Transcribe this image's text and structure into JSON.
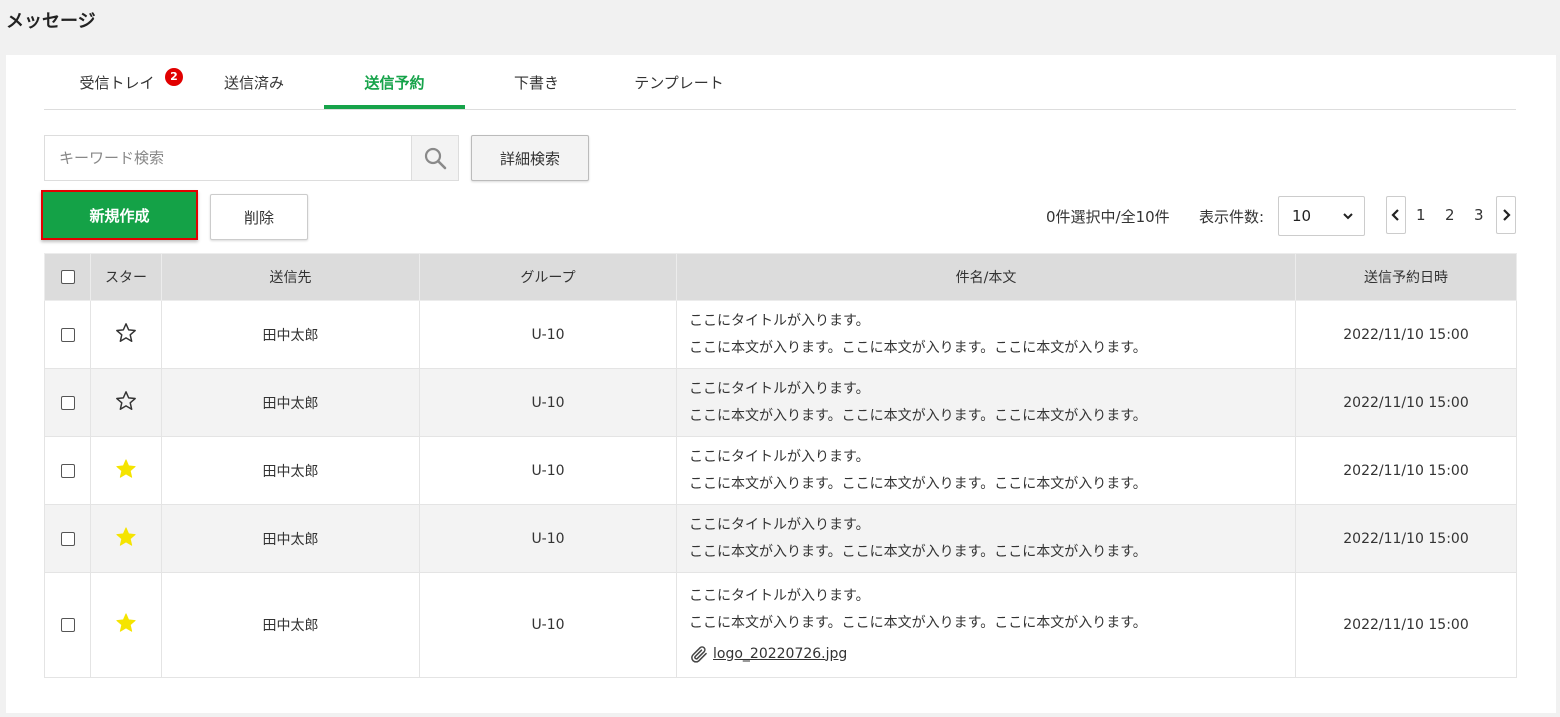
{
  "page": {
    "title": "メッセージ"
  },
  "tabs": [
    {
      "label": "受信トレイ",
      "badge": "2",
      "active": false
    },
    {
      "label": "送信済み",
      "active": false
    },
    {
      "label": "送信予約",
      "active": true
    },
    {
      "label": "下書き",
      "active": false
    },
    {
      "label": "テンプレート",
      "active": false
    }
  ],
  "search": {
    "placeholder": "キーワード検索",
    "value": "",
    "icon": "search-icon",
    "detail_label": "詳細検索"
  },
  "actions": {
    "new_label": "新規作成",
    "delete_label": "削除"
  },
  "selection": {
    "status": "0件選択中/全10件"
  },
  "per_page": {
    "label": "表示件数:",
    "value": "10"
  },
  "pagination": {
    "pages": [
      "1",
      "2",
      "3"
    ]
  },
  "table": {
    "headers": [
      "スター",
      "送信先",
      "グループ",
      "件名/本文",
      "送信予約日時"
    ],
    "rows": [
      {
        "starred": false,
        "recipient": "田中太郎",
        "group": "U-10",
        "title": "ここにタイトルが入ります。",
        "body": "ここに本文が入ります。ここに本文が入ります。ここに本文が入ります。",
        "datetime": "2022/11/10 15:00"
      },
      {
        "starred": false,
        "recipient": "田中太郎",
        "group": "U-10",
        "title": "ここにタイトルが入ります。",
        "body": "ここに本文が入ります。ここに本文が入ります。ここに本文が入ります。",
        "datetime": "2022/11/10 15:00"
      },
      {
        "starred": true,
        "recipient": "田中太郎",
        "group": "U-10",
        "title": "ここにタイトルが入ります。",
        "body": "ここに本文が入ります。ここに本文が入ります。ここに本文が入ります。",
        "datetime": "2022/11/10 15:00"
      },
      {
        "starred": true,
        "recipient": "田中太郎",
        "group": "U-10",
        "title": "ここにタイトルが入ります。",
        "body": "ここに本文が入ります。ここに本文が入ります。ここに本文が入ります。",
        "datetime": "2022/11/10 15:00"
      },
      {
        "starred": true,
        "recipient": "田中太郎",
        "group": "U-10",
        "title": "ここにタイトルが入ります。",
        "body": "ここに本文が入ります。ここに本文が入ります。ここに本文が入ります。",
        "datetime": "2022/11/10 15:00",
        "attachment": "logo_20220726.jpg"
      }
    ]
  },
  "colors": {
    "accent": "#16a34a",
    "button_green": "#14a247",
    "highlight_border": "#e20000",
    "badge": "#e10000",
    "star_filled": "#f5e400"
  }
}
